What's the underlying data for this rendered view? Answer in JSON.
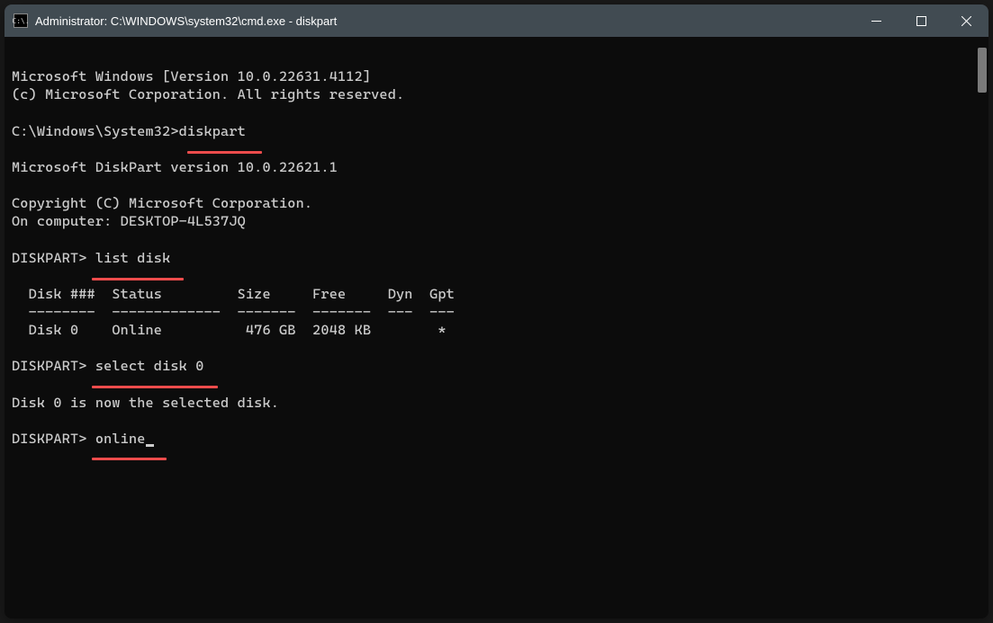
{
  "window": {
    "title": "Administrator: C:\\WINDOWS\\system32\\cmd.exe - diskpart",
    "icon_label": "C:\\."
  },
  "terminal": {
    "line1": "Microsoft Windows [Version 10.0.22631.4112]",
    "line2": "(c) Microsoft Corporation. All rights reserved.",
    "blank1": "",
    "prompt1_path": "C:\\Windows\\System32>",
    "prompt1_cmd": "diskpart",
    "blank2": "",
    "line4": "Microsoft DiskPart version 10.0.22621.1",
    "blank3": "",
    "line5": "Copyright (C) Microsoft Corporation.",
    "line6": "On computer: DESKTOP-4L537JQ",
    "blank4": "",
    "prompt2_label": "DISKPART> ",
    "prompt2_cmd": "list disk",
    "blank5": "",
    "table_header": "  Disk ###  Status         Size     Free     Dyn  Gpt",
    "table_divider": "  --------  -------------  -------  -------  ---  ---",
    "table_row": "  Disk 0    Online          476 GB  2048 KB        *",
    "blank6": "",
    "prompt3_label": "DISKPART> ",
    "prompt3_cmd": "select disk 0",
    "blank7": "",
    "line9": "Disk 0 is now the selected disk.",
    "blank8": "",
    "prompt4_label": "DISKPART> ",
    "prompt4_cmd": "online"
  },
  "annotations": {
    "underline1": "diskpart",
    "underline2": "list disk",
    "underline3": "select disk 0",
    "underline4": "online"
  }
}
